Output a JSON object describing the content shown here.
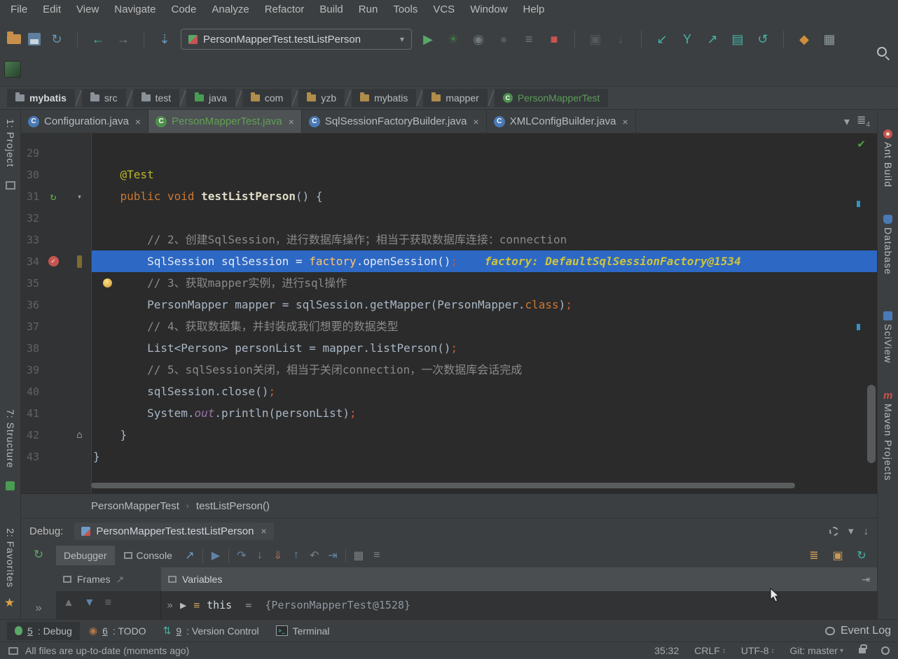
{
  "menu": {
    "items": [
      "File",
      "Edit",
      "View",
      "Navigate",
      "Code",
      "Analyze",
      "Refactor",
      "Build",
      "Run",
      "Tools",
      "VCS",
      "Window",
      "Help"
    ]
  },
  "toolbar": {
    "run_config_label": "PersonMapperTest.testListPerson",
    "group1": [
      {
        "name": "open-project-icon",
        "css": "folder"
      },
      {
        "name": "save-all-icon",
        "css": "save"
      },
      {
        "name": "sync-icon",
        "glyph": "↻",
        "color": "#6897bb"
      },
      {
        "sep": true
      },
      {
        "name": "back-icon",
        "glyph": "←",
        "color": "#45b3a7"
      },
      {
        "name": "forward-icon",
        "glyph": "→",
        "color": "#787f85"
      },
      {
        "sep": true
      },
      {
        "name": "annotate-icon",
        "glyph": "⇣",
        "color": "#6897bb"
      }
    ],
    "group2": [
      {
        "name": "run-icon",
        "glyph": "▶",
        "color": "#59a869"
      },
      {
        "name": "coverage-icon",
        "glyph": "☀",
        "color": "#3f7a43"
      },
      {
        "name": "profiler-icon",
        "glyph": "◉",
        "color": "#6f7a80"
      },
      {
        "name": "attach-icon",
        "glyph": "●",
        "color": "#54595c"
      },
      {
        "name": "build-artifacts-icon",
        "glyph": "≡",
        "color": "#6f7a80"
      },
      {
        "name": "stop-icon",
        "glyph": "■",
        "color": "#c75450"
      },
      {
        "sep": true
      },
      {
        "name": "restart-dim-icon",
        "glyph": "▣",
        "color": "#54595c"
      },
      {
        "name": "download-sources-icon",
        "glyph": "↓",
        "color": "#54595c"
      },
      {
        "sep": true
      },
      {
        "name": "update-project-icon",
        "glyph": "↙",
        "color": "#45b3a7"
      },
      {
        "name": "vcs-branch-icon",
        "glyph": "Y",
        "color": "#45b3a7"
      },
      {
        "name": "push-icon",
        "glyph": "↗",
        "color": "#45b3a7"
      },
      {
        "name": "window-arrow-icon",
        "glyph": "▤",
        "color": "#45b3a7"
      },
      {
        "name": "rollback-icon",
        "glyph": "↺",
        "color": "#45b3a7"
      },
      {
        "sep": true
      },
      {
        "name": "sdk-setup-icon",
        "glyph": "◆",
        "color": "#cf8e3c"
      },
      {
        "name": "table-icon",
        "glyph": "▦",
        "color": "#8f9a9f"
      }
    ]
  },
  "crumbs": {
    "items": [
      {
        "label": "mybatis",
        "icon": "folder",
        "fc": "#8a9199",
        "bold": true
      },
      {
        "label": "src",
        "icon": "folder",
        "fc": "#8a9199"
      },
      {
        "label": "test",
        "icon": "folder",
        "fc": "#8a9199"
      },
      {
        "label": "java",
        "icon": "folder",
        "fc": "#499c54"
      },
      {
        "label": "com",
        "icon": "folder",
        "fc": "#b08d4a"
      },
      {
        "label": "yzb",
        "icon": "folder",
        "fc": "#b08d4a"
      },
      {
        "label": "mybatis",
        "icon": "folder",
        "fc": "#b08d4a"
      },
      {
        "label": "mapper",
        "icon": "folder",
        "fc": "#b08d4a"
      },
      {
        "label": "PersonMapperTest",
        "icon": "class",
        "color": "#5c9b57"
      }
    ]
  },
  "tabs": {
    "items": [
      {
        "label": "Configuration.java",
        "color": "#b8bcbf",
        "icon": "#4a7ab5",
        "active": false
      },
      {
        "label": "PersonMapperTest.java",
        "color": "#61a054",
        "icon": "#4d8f4d",
        "active": true
      },
      {
        "label": "SqlSessionFactoryBuilder.java",
        "color": "#b8bcbf",
        "icon": "#4a7ab5",
        "active": false
      },
      {
        "label": "XMLConfigBuilder.java",
        "color": "#b8bcbf",
        "icon": "#4a7ab5",
        "active": false
      }
    ],
    "count": "4"
  },
  "left_stripe": {
    "project": "1: Project",
    "structure": "7: Structure",
    "favorites": "2: Favorites"
  },
  "right_stripe": {
    "ant": "Ant Build",
    "database": "Database",
    "sciview": "SciView",
    "maven": "Maven Projects"
  },
  "editor": {
    "lines": [
      {
        "n": "29",
        "seg": []
      },
      {
        "n": "30",
        "seg": [
          {
            "t": "    ",
            "c": "p"
          },
          {
            "t": "@Test",
            "c": "a"
          }
        ]
      },
      {
        "n": "31",
        "g": [
          "run",
          "arrow"
        ],
        "seg": [
          {
            "t": "    ",
            "c": "p"
          },
          {
            "t": "public void ",
            "c": "k"
          },
          {
            "t": "testListPerson",
            "c": "m"
          },
          {
            "t": "() {",
            "c": "p"
          }
        ]
      },
      {
        "n": "32",
        "seg": []
      },
      {
        "n": "33",
        "seg": [
          {
            "t": "        ",
            "c": "p"
          },
          {
            "t": "// 2、创建SqlSession，进行数据库操作；相当于获取数据库连接：connection",
            "c": "c"
          }
        ]
      },
      {
        "n": "34",
        "hl": true,
        "g": [
          "bp",
          "exec"
        ],
        "seg": [
          {
            "t": "        ",
            "c": "p"
          },
          {
            "t": "SqlSession sqlSession = ",
            "c": "p"
          },
          {
            "t": "factory",
            "c": "v"
          },
          {
            "t": ".openSession()",
            "c": "p"
          },
          {
            "t": ";",
            "c": "s"
          },
          {
            "t": "    ",
            "c": "p"
          },
          {
            "t": "factory: DefaultSqlSessionFactory@1534",
            "c": "hint"
          }
        ]
      },
      {
        "n": "35",
        "g": [
          "bulb"
        ],
        "seg": [
          {
            "t": "        ",
            "c": "p"
          },
          {
            "t": "// 3、获取mapper实例，进行sql操作",
            "c": "c"
          }
        ]
      },
      {
        "n": "36",
        "seg": [
          {
            "t": "        ",
            "c": "p"
          },
          {
            "t": "PersonMapper mapper = sqlSession.getMapper(PersonMapper.",
            "c": "p"
          },
          {
            "t": "class",
            "c": "k"
          },
          {
            "t": ")",
            "c": "p"
          },
          {
            "t": ";",
            "c": "s"
          }
        ]
      },
      {
        "n": "37",
        "seg": [
          {
            "t": "        ",
            "c": "p"
          },
          {
            "t": "// 4、获取数据集，并封装成我们想要的数据类型",
            "c": "c"
          }
        ]
      },
      {
        "n": "38",
        "seg": [
          {
            "t": "        ",
            "c": "p"
          },
          {
            "t": "List<Person> personList = mapper.listPerson()",
            "c": "p"
          },
          {
            "t": ";",
            "c": "s"
          }
        ]
      },
      {
        "n": "39",
        "seg": [
          {
            "t": "        ",
            "c": "p"
          },
          {
            "t": "// 5、sqlSession关闭，相当于关闭connection，一次数据库会话完成",
            "c": "c"
          }
        ]
      },
      {
        "n": "40",
        "seg": [
          {
            "t": "        ",
            "c": "p"
          },
          {
            "t": "sqlSession.close()",
            "c": "p"
          },
          {
            "t": ";",
            "c": "s"
          }
        ]
      },
      {
        "n": "41",
        "seg": [
          {
            "t": "        ",
            "c": "p"
          },
          {
            "t": "System.",
            "c": "p"
          },
          {
            "t": "out",
            "c": "f"
          },
          {
            "t": ".println(personList)",
            "c": "p"
          },
          {
            "t": ";",
            "c": "s"
          }
        ]
      },
      {
        "n": "42",
        "g": [
          "home"
        ],
        "seg": [
          {
            "t": "    }",
            "c": "p"
          }
        ]
      },
      {
        "n": "43",
        "seg": [
          {
            "t": "}",
            "c": "p"
          }
        ]
      }
    ]
  },
  "navcrumb": {
    "cls": "PersonMapperTest",
    "sep": "›",
    "method": "testListPerson()"
  },
  "debug": {
    "label": "Debug:",
    "session_tab": "PersonMapperTest.testListPerson",
    "close": "×",
    "tabs": {
      "debugger": "Debugger",
      "console": "Console"
    },
    "toolbar_icons": [
      {
        "name": "jump-to-output-icon",
        "glyph": "↗",
        "color": "#6e9bc5"
      },
      {
        "sep": true
      },
      {
        "name": "show-execution-point-icon",
        "glyph": "▶",
        "color": "#5f84a8"
      },
      {
        "sep": true
      },
      {
        "name": "step-over-icon",
        "glyph": "↷",
        "color": "#5f84a8"
      },
      {
        "name": "step-into-icon",
        "glyph": "↓",
        "color": "#5f84a8"
      },
      {
        "name": "force-step-into-icon",
        "glyph": "⇓",
        "color": "#9f6a52"
      },
      {
        "name": "step-out-icon",
        "glyph": "↑",
        "color": "#5f84a8"
      },
      {
        "name": "drop-frame-icon",
        "glyph": "↶",
        "color": "#7a7f83"
      },
      {
        "name": "run-to-cursor-icon",
        "glyph": "⇥",
        "color": "#5f84a8"
      },
      {
        "sep": true
      },
      {
        "name": "evaluate-expression-icon",
        "glyph": "▦",
        "color": "#7a7f83"
      },
      {
        "name": "more-options-icon",
        "glyph": "≡",
        "color": "#7a7f83"
      }
    ],
    "right_icons": [
      {
        "name": "restore-layout-icon",
        "glyph": "≣",
        "color": "#c79a58"
      },
      {
        "name": "thread-dump-icon",
        "glyph": "▣",
        "color": "#c79a58"
      },
      {
        "name": "debugger-settings-icon",
        "glyph": "↻",
        "color": "#45b3a7"
      }
    ],
    "frames_label": "Frames",
    "variables_label": "Variables",
    "frames_icons": [
      {
        "name": "frame-up-icon",
        "glyph": "▲",
        "color": "#6f7477"
      },
      {
        "name": "frame-down-icon",
        "glyph": "▼",
        "color": "#5f84a8"
      },
      {
        "name": "frame-menu-icon",
        "glyph": "≡",
        "color": "#6f7477"
      }
    ],
    "vars_icons": [
      {
        "name": "collapse-icon",
        "glyph": "»",
        "color": "#8a8f93"
      },
      {
        "name": "expand-node-icon",
        "glyph": "▶",
        "color": "#b8bcbf"
      },
      {
        "name": "field-icon",
        "glyph": "≡",
        "color": "#c79a58"
      }
    ],
    "variable": {
      "name": "this",
      "eq": " = ",
      "value": "{PersonMapperTest@1528}"
    },
    "col_icons": [
      {
        "name": "rerun-icon",
        "glyph": "↻",
        "color": "#59a869"
      },
      {
        "name": "hidden-tabs-icon",
        "glyph": "»",
        "color": "#8a8f93"
      }
    ]
  },
  "toolwindows": {
    "items": [
      {
        "num": "5",
        "label": ": Debug",
        "icon": "bug",
        "active": true
      },
      {
        "num": "6",
        "label": ": TODO",
        "icon": "todo",
        "active": false
      },
      {
        "num": "9",
        "label": ": Version Control",
        "icon": "vcs",
        "active": false
      },
      {
        "num": "",
        "label": "Terminal",
        "icon": "terminal",
        "active": false
      }
    ],
    "event_log": "Event Log"
  },
  "status": {
    "message": "All files are up-to-date (moments ago)",
    "position": "35:32",
    "line_sep": "CRLF",
    "encoding": "UTF-8",
    "git": "Git: master"
  }
}
